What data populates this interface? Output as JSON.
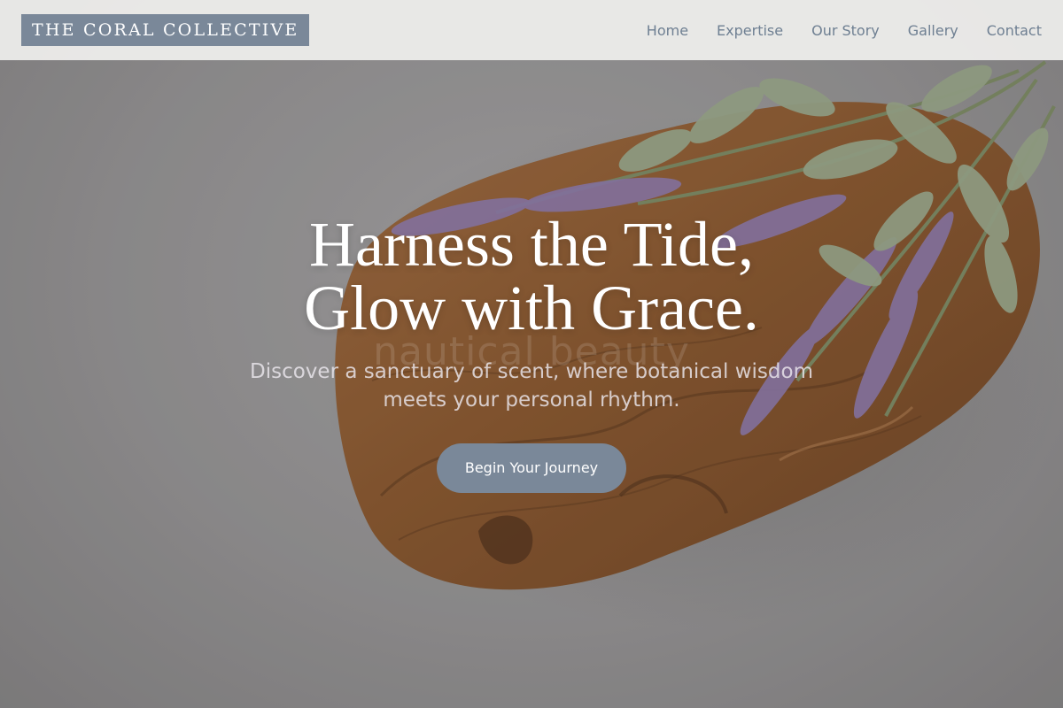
{
  "brand": {
    "name": "THE CORAL COLLECTIVE"
  },
  "nav": {
    "items": [
      {
        "label": "Home"
      },
      {
        "label": "Expertise"
      },
      {
        "label": "Our Story"
      },
      {
        "label": "Gallery"
      },
      {
        "label": "Contact"
      }
    ]
  },
  "hero": {
    "title_line1": "Harness the Tide,",
    "title_line2": "Glow with Grace.",
    "ghost_text": "nautical beauty",
    "subtitle": "Discover a sanctuary of scent, where botanical wisdom meets your personal rhythm.",
    "cta_label": "Begin Your Journey",
    "background_image": "hero-photo-wood-board-lavender"
  },
  "colors": {
    "accent": "#7a8899",
    "nav_text": "#6e7f92",
    "header_bg": "#f0f0ee"
  }
}
